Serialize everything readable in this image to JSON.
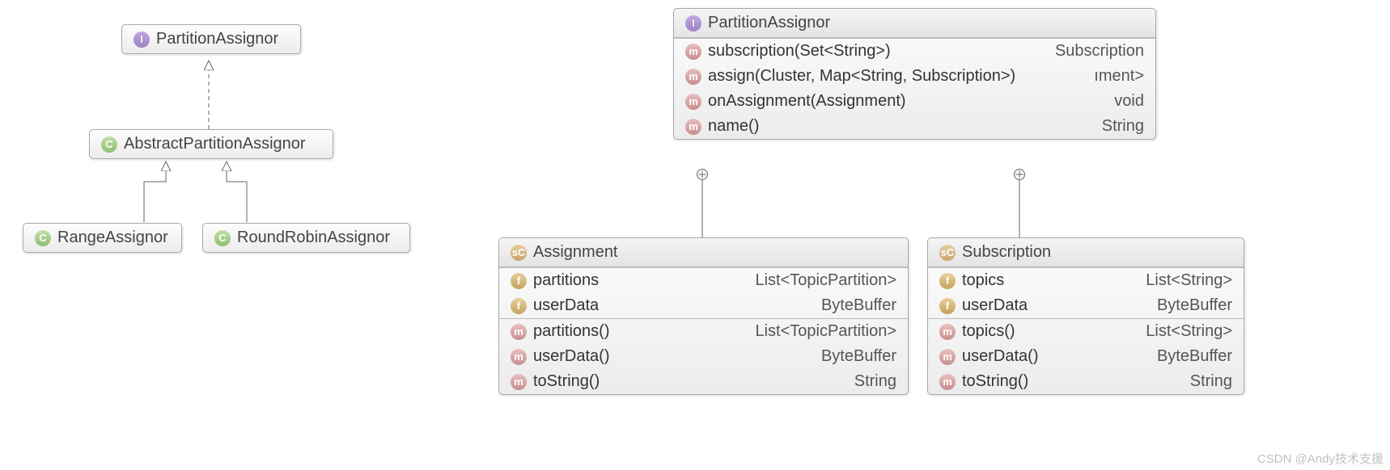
{
  "left": {
    "interface": {
      "icon": "I",
      "name": "PartitionAssignor"
    },
    "abstract": {
      "icon": "C",
      "name": "AbstractPartitionAssignor"
    },
    "range": {
      "icon": "C",
      "name": "RangeAssignor"
    },
    "robin": {
      "icon": "C",
      "name": "RoundRobinAssignor"
    }
  },
  "right": {
    "interface": {
      "icon": "I",
      "name": "PartitionAssignor",
      "methods": [
        {
          "sig": "subscription(Set<String>)",
          "ret": "Subscription"
        },
        {
          "sig": "assign(Cluster, Map<String, Subscription>)",
          "ret": "ıment>"
        },
        {
          "sig": "onAssignment(Assignment)",
          "ret": "void"
        },
        {
          "sig": "name()",
          "ret": "String"
        }
      ]
    },
    "assignment": {
      "icon": "sC",
      "name": "Assignment",
      "fields": [
        {
          "sig": "partitions",
          "ret": "List<TopicPartition>"
        },
        {
          "sig": "userData",
          "ret": "ByteBuffer"
        }
      ],
      "methods": [
        {
          "sig": "partitions()",
          "ret": "List<TopicPartition>"
        },
        {
          "sig": "userData()",
          "ret": "ByteBuffer"
        },
        {
          "sig": "toString()",
          "ret": "String"
        }
      ]
    },
    "subscription": {
      "icon": "sC",
      "name": "Subscription",
      "fields": [
        {
          "sig": "topics",
          "ret": "List<String>"
        },
        {
          "sig": "userData",
          "ret": "ByteBuffer"
        }
      ],
      "methods": [
        {
          "sig": "topics()",
          "ret": "List<String>"
        },
        {
          "sig": "userData()",
          "ret": "ByteBuffer"
        },
        {
          "sig": "toString()",
          "ret": "String"
        }
      ]
    }
  },
  "watermark": "CSDN @Andy技术支援"
}
